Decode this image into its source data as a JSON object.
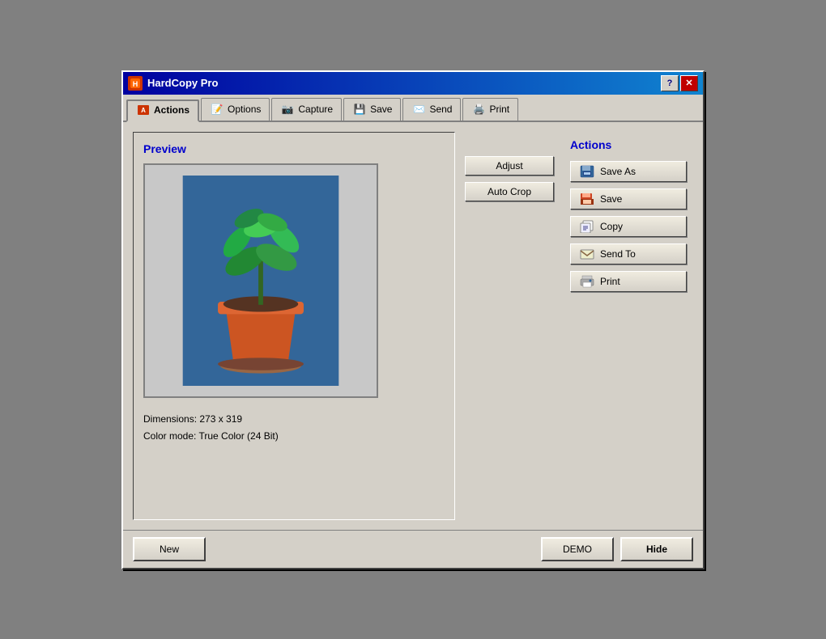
{
  "titlebar": {
    "title": "HardCopy Pro",
    "help_label": "?",
    "close_label": "✕"
  },
  "tabs": [
    {
      "id": "actions",
      "label": "Actions",
      "active": true,
      "icon": "📋"
    },
    {
      "id": "options",
      "label": "Options",
      "active": false,
      "icon": "📝"
    },
    {
      "id": "capture",
      "label": "Capture",
      "active": false,
      "icon": "📷"
    },
    {
      "id": "save",
      "label": "Save",
      "active": false,
      "icon": "💾"
    },
    {
      "id": "send",
      "label": "Send",
      "active": false,
      "icon": "✉️"
    },
    {
      "id": "print",
      "label": "Print",
      "active": false,
      "icon": "🖨️"
    }
  ],
  "preview": {
    "title": "Preview",
    "dimensions_label": "Dimensions: 273 x 319",
    "colormode_label": "Color mode:  True Color (24 Bit)"
  },
  "mid_buttons": {
    "adjust": "Adjust",
    "auto_crop": "Auto Crop"
  },
  "actions": {
    "title": "Actions",
    "buttons": [
      {
        "id": "save-as",
        "label": "Save As",
        "icon": "💾"
      },
      {
        "id": "save",
        "label": "Save",
        "icon": "📋"
      },
      {
        "id": "copy",
        "label": "Copy",
        "icon": "📄"
      },
      {
        "id": "send-to",
        "label": "Send To",
        "icon": "✉️"
      },
      {
        "id": "print",
        "label": "Print",
        "icon": "🖨️"
      }
    ]
  },
  "bottom": {
    "new_label": "New",
    "demo_label": "DEMO",
    "hide_label": "Hide"
  }
}
